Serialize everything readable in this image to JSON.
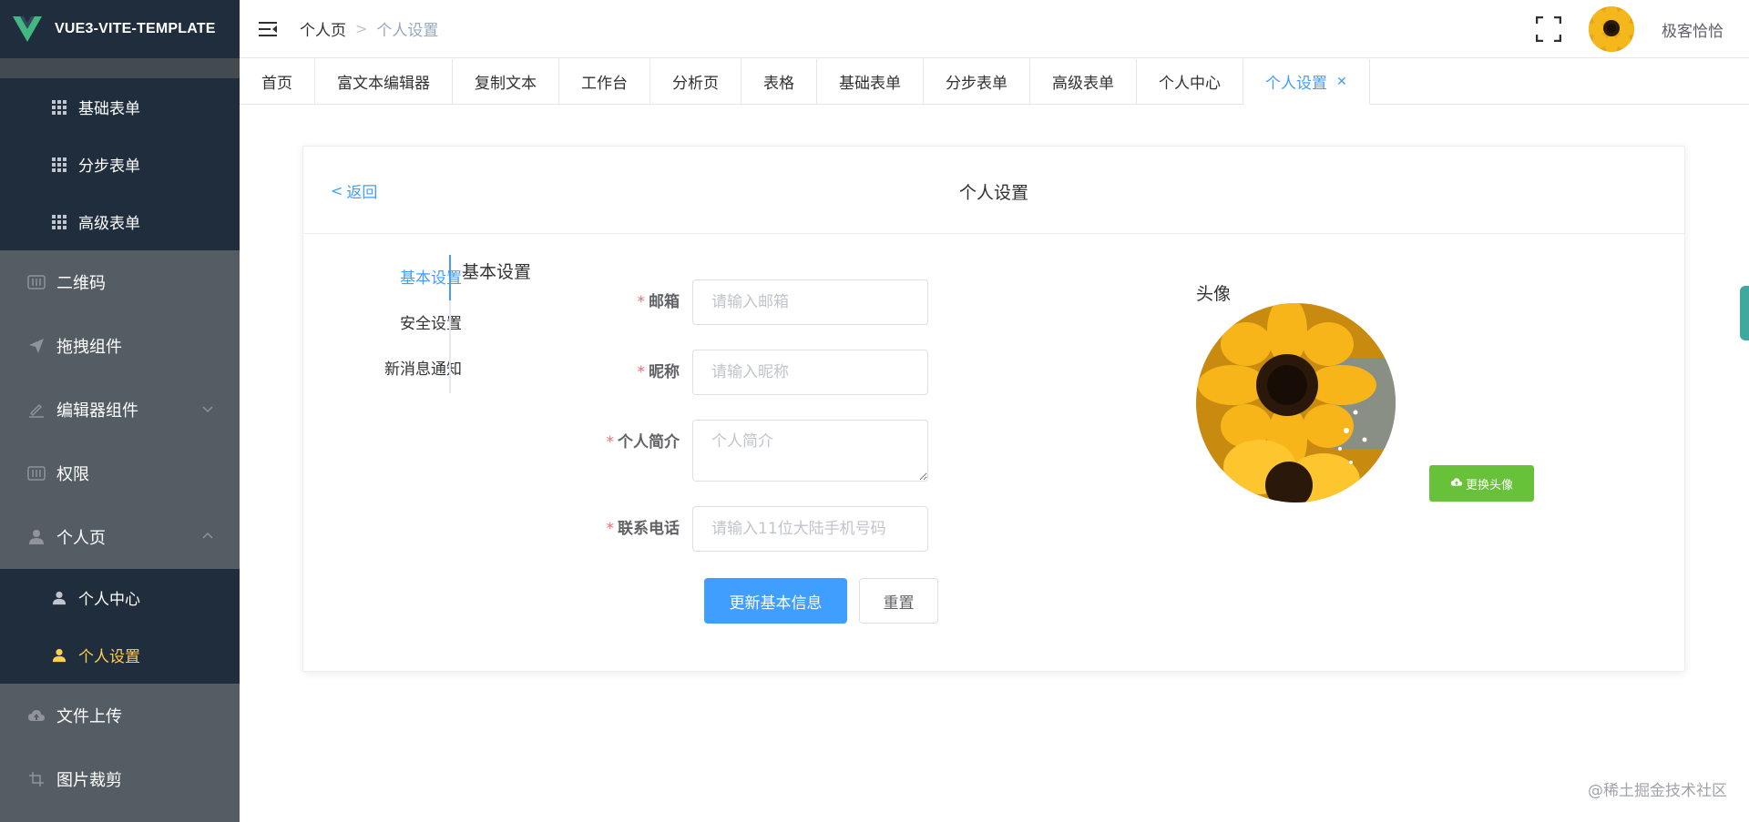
{
  "app": {
    "title": "VUE3-VITE-TEMPLATE"
  },
  "sidebar": {
    "group_form": [
      {
        "label": "基础表单",
        "icon": "grid-icon"
      },
      {
        "label": "分步表单",
        "icon": "grid-icon"
      },
      {
        "label": "高级表单",
        "icon": "grid-icon"
      }
    ],
    "items": [
      {
        "label": "二维码",
        "icon": "barcode-icon"
      },
      {
        "label": "拖拽组件",
        "icon": "send-icon"
      },
      {
        "label": "编辑器组件",
        "icon": "edit-icon"
      },
      {
        "label": "权限",
        "icon": "barcode-icon"
      },
      {
        "label": "个人页",
        "icon": "user-icon"
      },
      {
        "label": "文件上传",
        "icon": "cloud-upload-icon"
      },
      {
        "label": "图片裁剪",
        "icon": "crop-icon"
      }
    ],
    "group_personal": [
      {
        "label": "个人中心",
        "icon": "user-icon"
      },
      {
        "label": "个人设置",
        "icon": "user-icon",
        "active": true
      }
    ]
  },
  "header": {
    "breadcrumb": [
      "个人页",
      "个人设置"
    ],
    "username": "极客恰恰"
  },
  "tabs": [
    "首页",
    "富文本编辑器",
    "复制文本",
    "工作台",
    "分析页",
    "表格",
    "基础表单",
    "分步表单",
    "高级表单",
    "个人中心",
    "个人设置"
  ],
  "card": {
    "back_label": "返回",
    "title": "个人设置",
    "vtabs": [
      "基本设置",
      "安全设置",
      "新消息通知"
    ],
    "section_title": "基本设置",
    "form": {
      "email_label": "邮箱",
      "email_placeholder": "请输入邮箱",
      "nickname_label": "昵称",
      "nickname_placeholder": "请输入昵称",
      "bio_label": "个人简介",
      "bio_placeholder": "个人简介",
      "phone_label": "联系电话",
      "phone_placeholder": "请输入11位大陆手机号码",
      "submit_label": "更新基本信息",
      "reset_label": "重置"
    },
    "avatar_title": "头像",
    "change_avatar_label": "更换头像"
  },
  "watermark": "@稀土掘金技术社区",
  "colors": {
    "primary": "#409eff",
    "success": "#67c23a",
    "sidebar_bg": "#545c64",
    "submenu_bg": "#1f2d3d",
    "active_text": "#ffd04b"
  }
}
